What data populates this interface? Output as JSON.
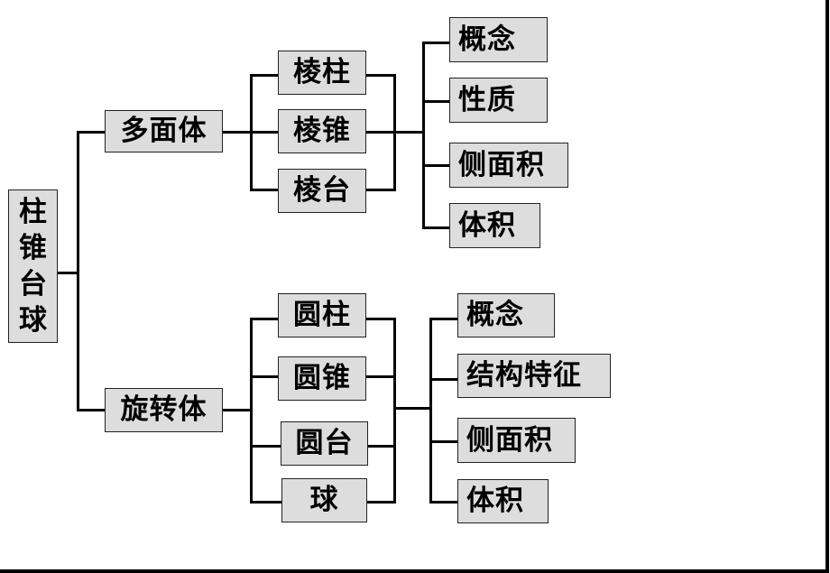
{
  "diagram": {
    "title": "柱锥台球",
    "root": {
      "label": "柱锥台球",
      "characters": [
        "柱",
        "锥",
        "台",
        "球"
      ]
    },
    "branches": [
      {
        "label": "多面体",
        "children": [
          "棱柱",
          "棱锥",
          "棱台"
        ],
        "topics": [
          "概念",
          "性质",
          "侧面积",
          "体积"
        ]
      },
      {
        "label": "旋转体",
        "children": [
          "圆柱",
          "圆锥",
          "圆台",
          "球"
        ],
        "topics": [
          "概念",
          "结构特征",
          "侧面积",
          "体积"
        ]
      }
    ]
  },
  "colors": {
    "box_fill": "#dddddd",
    "box_border": "#222222",
    "line": "#000000",
    "background": "#ffffff"
  }
}
